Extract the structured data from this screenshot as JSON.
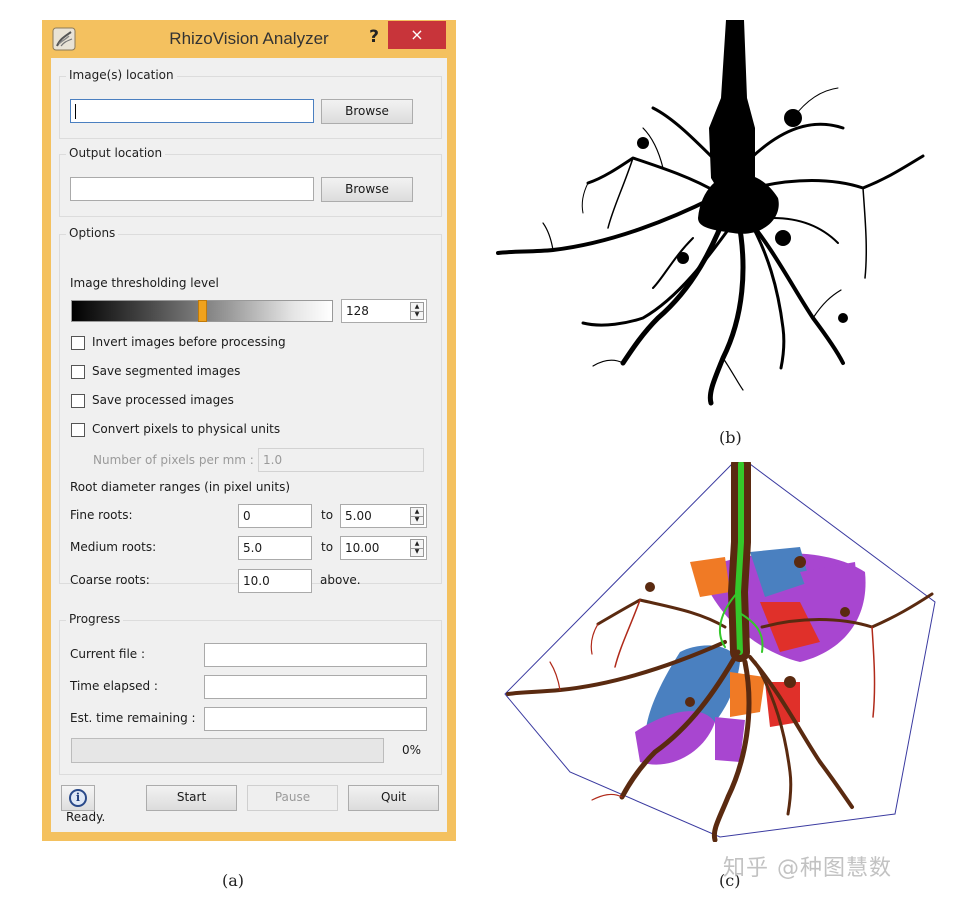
{
  "window": {
    "title": "RhizoVision Analyzer",
    "help_label": "?",
    "close_label": "×"
  },
  "image_location": {
    "group_label": "Image(s) location",
    "value": "",
    "browse_label": "Browse"
  },
  "output_location": {
    "group_label": "Output location",
    "value": "",
    "browse_label": "Browse"
  },
  "options": {
    "group_label": "Options",
    "threshold_label": "Image thresholding level",
    "threshold_value": "128",
    "threshold_fraction": 0.502,
    "checkboxes": [
      {
        "label": "Invert images before processing",
        "checked": false
      },
      {
        "label": "Save segmented images",
        "checked": false
      },
      {
        "label": "Save processed images",
        "checked": false
      },
      {
        "label": "Convert pixels to physical units",
        "checked": false
      }
    ],
    "pixels_per_mm_label": "Number of pixels per mm :",
    "pixels_per_mm_value": "1.0",
    "diameter_ranges_label": "Root diameter ranges (in pixel units)",
    "ranges": [
      {
        "label": "Fine roots:",
        "from": "0",
        "to_label": "to",
        "to": "5.00"
      },
      {
        "label": "Medium roots:",
        "from": "5.0",
        "to_label": "to",
        "to": "10.00"
      },
      {
        "label": "Coarse roots:",
        "from": "10.0",
        "to_label": "above.",
        "to": ""
      }
    ]
  },
  "progress": {
    "group_label": "Progress",
    "current_file_label": "Current file :",
    "current_file_value": "",
    "time_elapsed_label": "Time elapsed :",
    "time_elapsed_value": "",
    "time_remaining_label": "Est. time remaining :",
    "time_remaining_value": "",
    "percent_label": "0%",
    "percent": 0
  },
  "buttons": {
    "info_icon": "info-icon",
    "start_label": "Start",
    "pause_label": "Pause",
    "quit_label": "Quit"
  },
  "status": "Ready.",
  "captions": {
    "a": "(a)",
    "b": "(b)",
    "c": "(c)"
  },
  "watermark": "知乎 @种图慧数",
  "colors": {
    "window_frame": "#f4c15f",
    "close_button": "#c8343a",
    "slider_thumb": "#f0a21c",
    "root_skeleton": "#000000",
    "medial_axis": "#35c82a",
    "region_purple": "#a846d0",
    "region_blue": "#4a80c0",
    "region_orange": "#f07a25",
    "region_red": "#e0302a",
    "root_outline": "#7a1a10",
    "hull_line": "#3a3aa0"
  }
}
